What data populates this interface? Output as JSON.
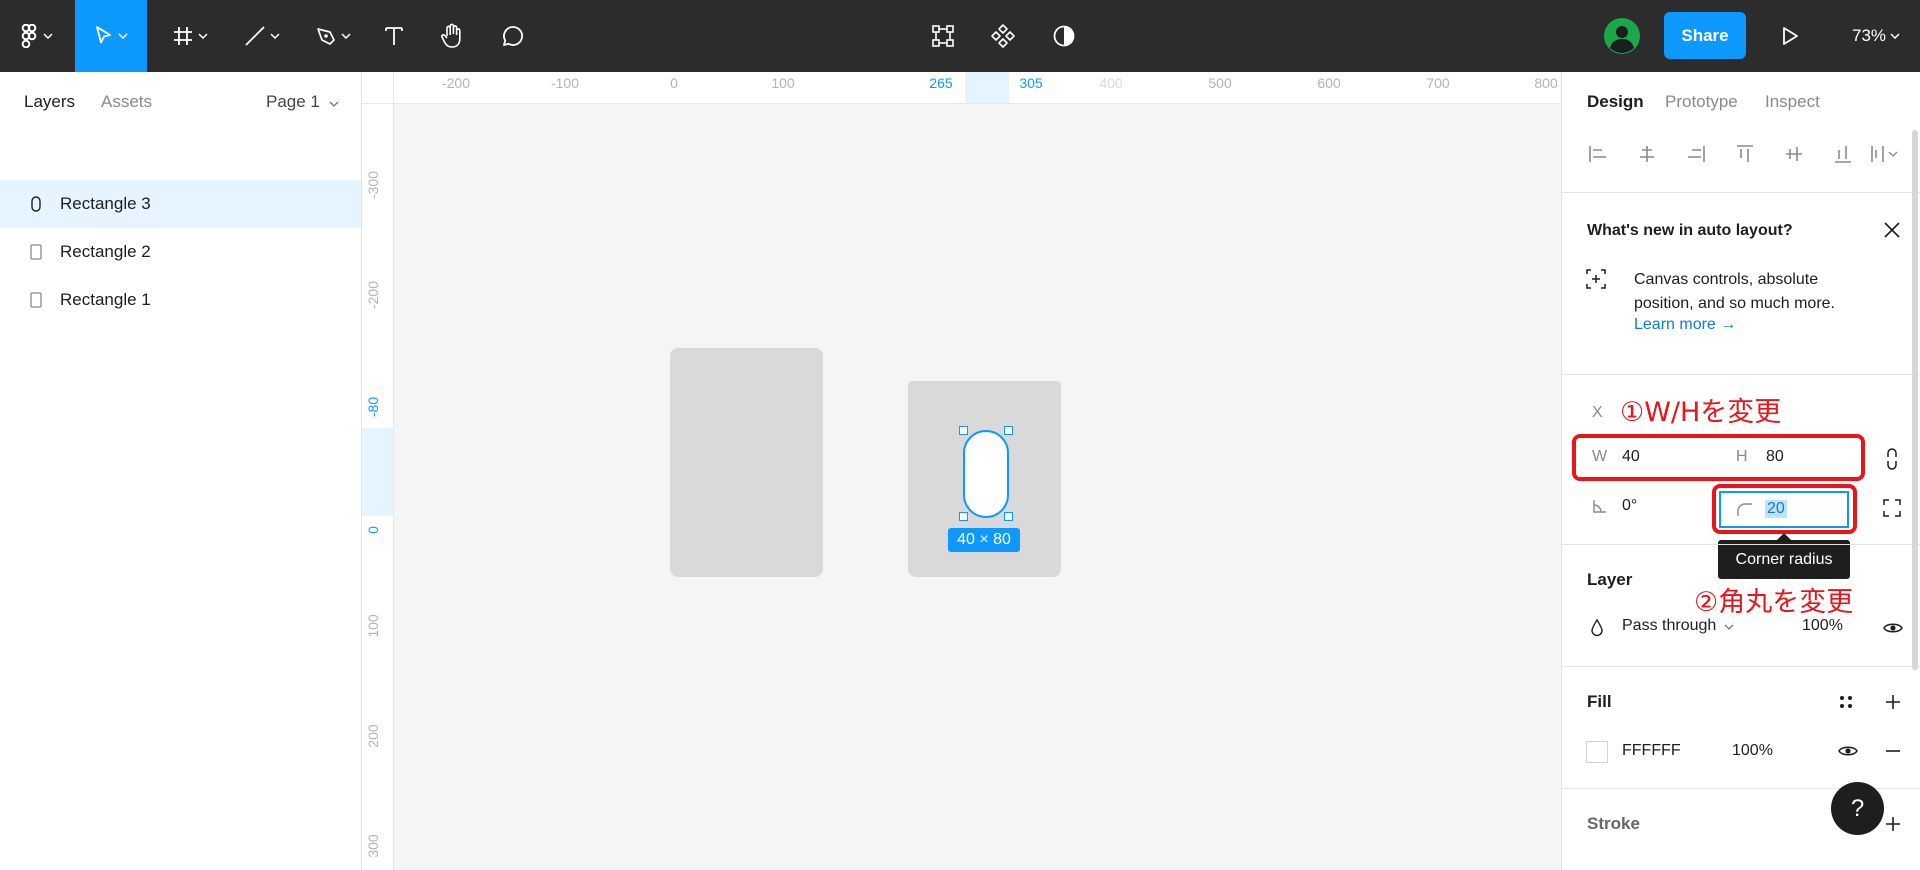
{
  "toolbar": {
    "zoom": "73%",
    "share_label": "Share"
  },
  "left_panel": {
    "tab_layers": "Layers",
    "tab_assets": "Assets",
    "page": "Page 1",
    "layers": [
      {
        "name": "Rectangle 3",
        "selected": true
      },
      {
        "name": "Rectangle 2",
        "selected": false
      },
      {
        "name": "Rectangle 1",
        "selected": false
      }
    ]
  },
  "rulers": {
    "top": [
      "-200",
      "-100",
      "0",
      "100",
      "265",
      "305",
      "400",
      "500",
      "600",
      "700",
      "800"
    ],
    "left": [
      "-300",
      "-200",
      "-80",
      "0",
      "100",
      "200",
      "300"
    ]
  },
  "canvas": {
    "dimension_label": "40 × 80"
  },
  "right_panel": {
    "tab_design": "Design",
    "tab_prototype": "Prototype",
    "tab_inspect": "Inspect",
    "whats_new_title": "What's new in auto layout?",
    "whats_new_desc": "Canvas controls, absolute position, and so much more.",
    "learn_more": "Learn more →",
    "x_label": "X",
    "w_label": "W",
    "w_value": "40",
    "h_label": "H",
    "h_value": "80",
    "rotation": "0°",
    "corner_radius": "20",
    "tooltip": "Corner radius",
    "annotation_1": "①W/Hを変更",
    "annotation_2": "②角丸を変更",
    "layer_title": "Layer",
    "blend_mode": "Pass through",
    "layer_opacity": "100%",
    "fill_title": "Fill",
    "fill_hex": "FFFFFF",
    "fill_opacity": "100%",
    "stroke_title": "Stroke"
  },
  "help_label": "?",
  "colors": {
    "accent": "#0d99ff",
    "annotation_red": "#e8151b",
    "toolbar_bg": "#2c2c2c",
    "avatar_green": "#1aa84a"
  }
}
